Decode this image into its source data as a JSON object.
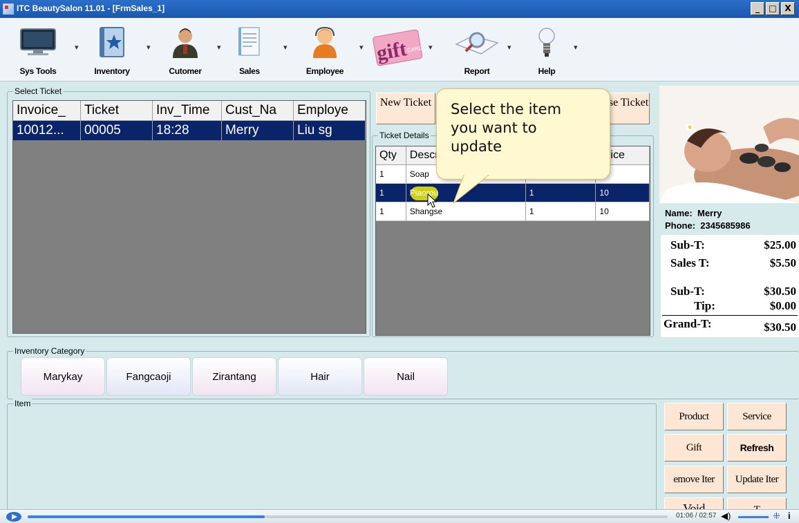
{
  "window": {
    "title": "ITC BeautySalon 11.01 - [FrmSales_1]",
    "min": "_",
    "max": "□",
    "close": "X"
  },
  "toolbar": [
    {
      "label": "Sys Tools",
      "icon": "monitor-icon"
    },
    {
      "label": "Inventory",
      "icon": "inventory-book-icon"
    },
    {
      "label": "Cutomer",
      "icon": "customer-person-icon"
    },
    {
      "label": "Sales",
      "icon": "sales-document-icon"
    },
    {
      "label": "Employee",
      "icon": "employee-headset-icon"
    },
    {
      "label": "",
      "icon": "gift-card-icon",
      "logo_text": "gift",
      "logo_sub": "CARD"
    },
    {
      "label": "Report",
      "icon": "report-magnifier-icon"
    },
    {
      "label": "Help",
      "icon": "help-lightbulb-icon"
    }
  ],
  "select_ticket": {
    "title": "Select Ticket",
    "columns": [
      "Invoice_",
      "Ticket",
      "Inv_Time",
      "Cust_Na",
      "Employe"
    ],
    "rows": [
      [
        "10012...",
        "00005",
        "18:28",
        "Merry",
        "Liu sg"
      ]
    ]
  },
  "ticket_buttons": {
    "new": "New Ticket",
    "close": "Close Ticket"
  },
  "ticket_detail": {
    "title": "Ticket Details",
    "columns": [
      "Qty",
      "Description",
      "",
      "Price"
    ],
    "rows": [
      [
        "1",
        "Soap",
        "",
        ""
      ],
      [
        "1",
        "Piaorou",
        "1",
        "10"
      ],
      [
        "1",
        "Shangse",
        "1",
        "10"
      ]
    ]
  },
  "callout": {
    "text": "Select the item you want to update"
  },
  "customer": {
    "name_label": "Name:",
    "name": "Merry",
    "phone_label": "Phone:",
    "phone": "2345685986"
  },
  "summary": {
    "subtotal_label": "Sub-T:",
    "subtotal": "$25.00",
    "sales_tax_label": "Sales T:",
    "sales_tax": "$5.50",
    "subtotal2_label": "Sub-T:",
    "subtotal2": "$30.50",
    "tip_label": "Tip:",
    "tip": "$0.00",
    "grand_label": "Grand-T:",
    "grand": "$30.50"
  },
  "inventory_category": {
    "title": "Inventory Category",
    "items": [
      "Marykay",
      "Fangcaoji",
      "Zirantang",
      "Hair",
      "Nail"
    ]
  },
  "item_group": {
    "title": "Item"
  },
  "actions": {
    "product": "Product",
    "service": "Service",
    "gift": "Gift",
    "refresh": "Refresh",
    "remove": "emove Iter",
    "update": "Update Iter",
    "void": "Void",
    "other": "T"
  },
  "video": {
    "time": "01:06 / 02:57",
    "progress": 0.37
  },
  "colors": {
    "selection": "#0a246a",
    "accent": "#1b56b0",
    "button": "#fde8d6",
    "callout": "#fff8d0"
  }
}
